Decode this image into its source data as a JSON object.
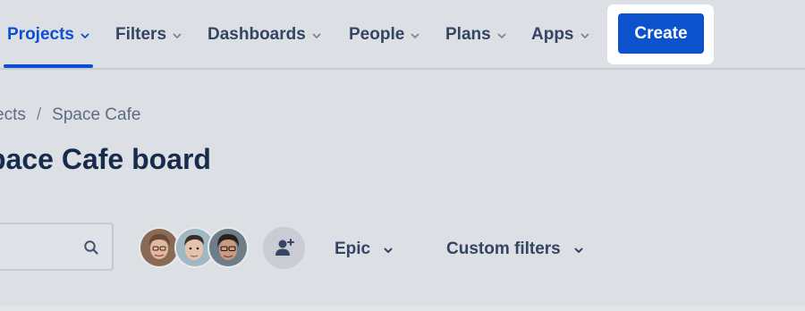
{
  "nav": {
    "items": [
      {
        "label": "Projects",
        "active": true
      },
      {
        "label": "Filters",
        "active": false
      },
      {
        "label": "Dashboards",
        "active": false
      },
      {
        "label": "People",
        "active": false
      },
      {
        "label": "Plans",
        "active": false
      },
      {
        "label": "Apps",
        "active": false
      }
    ],
    "create_label": "Create"
  },
  "breadcrumb": {
    "items": [
      "ects",
      "Space Cafe"
    ],
    "separator": "/"
  },
  "page": {
    "title": "pace Cafe board"
  },
  "toolbar": {
    "search_icon": "search-icon",
    "avatars": [
      "avatar-user-1",
      "avatar-user-2",
      "avatar-user-3"
    ],
    "add_people_icon": "add-person-icon",
    "epic_label": "Epic",
    "custom_filters_label": "Custom filters"
  },
  "colors": {
    "accent": "#0c52cc",
    "background": "#dcdfe4",
    "text_primary": "#172b4d",
    "text_secondary": "#344563"
  }
}
